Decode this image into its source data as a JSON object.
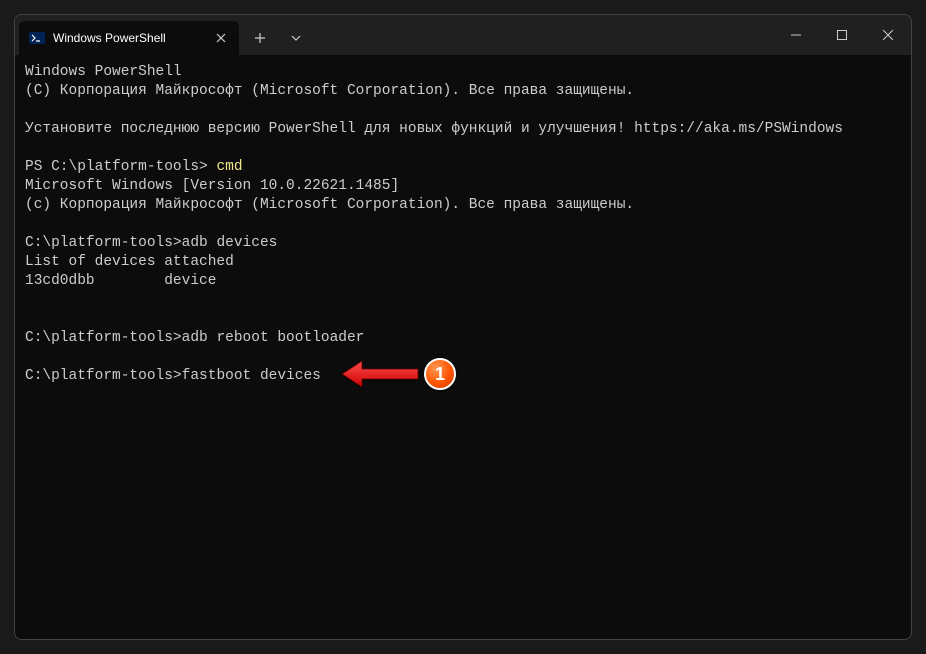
{
  "tab": {
    "title": "Windows PowerShell"
  },
  "terminal": {
    "line1": "Windows PowerShell",
    "line2": "(C) Корпорация Майкрософт (Microsoft Corporation). Все права защищены.",
    "line3": "Установите последнюю версию PowerShell для новых функций и улучшения! https://aka.ms/PSWindows",
    "prompt_ps": "PS C:\\platform-tools> ",
    "cmd1": "cmd",
    "line5": "Microsoft Windows [Version 10.0.22621.1485]",
    "line6": "(c) Корпорация Майкрософт (Microsoft Corporation). Все права защищены.",
    "prompt_cmd": "C:\\platform-tools>",
    "cmd2": "adb devices",
    "line8": "List of devices attached",
    "line9": "13cd0dbb        device",
    "cmd3": "adb reboot bootloader",
    "cmd4": "fastboot devices"
  },
  "annotation": {
    "number": "1"
  }
}
